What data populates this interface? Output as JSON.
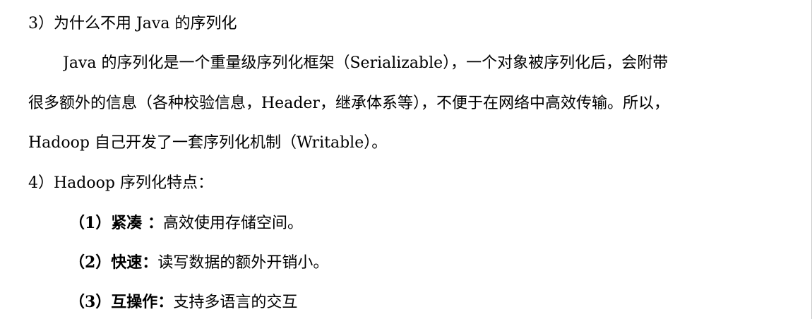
{
  "doc": {
    "lines": [
      {
        "text": "3）为什么不用 Java 的序列化"
      },
      {
        "text": "Java 的序列化是一个重量级序列化框架（Serializable），一个对象被序列化后，会附带"
      },
      {
        "text": "很多额外的信息（各种校验信息，Header，继承体系等），不便于在网络中高效传输。所以，"
      },
      {
        "text": "Hadoop 自己开发了一套序列化机制（Writable）。"
      },
      {
        "text": "4）Hadoop 序列化特点："
      }
    ],
    "items": [
      {
        "label": "（1）紧凑 ：",
        "text": "高效使用存储空间。"
      },
      {
        "label": "（2）快速：",
        "text": "读写数据的额外开销小。"
      },
      {
        "label": "（3）互操作：",
        "text": "支持多语言的交互"
      }
    ]
  }
}
